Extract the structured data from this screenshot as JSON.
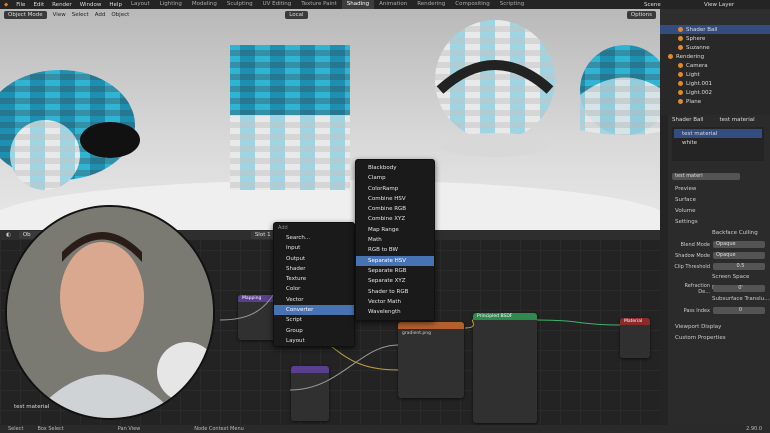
{
  "menubar": {
    "items": [
      "File",
      "Edit",
      "Render",
      "Window",
      "Help"
    ],
    "workspaces": [
      "Layout",
      "Lighting",
      "Modeling",
      "Sculpting",
      "UV Editing",
      "Texture Paint",
      "Shading",
      "Animation",
      "Rendering",
      "Compositing",
      "Scripting"
    ],
    "active_workspace": "Shading",
    "scene_label": "Scene",
    "view_layer_label": "View Layer"
  },
  "viewport": {
    "mode": "Object Mode",
    "menus": [
      "View",
      "Select",
      "Add",
      "Object"
    ],
    "orientation": "Local",
    "options": "Options"
  },
  "outliner": {
    "items": [
      {
        "label": "Shader Ball",
        "selected": true
      },
      {
        "label": "Sphere",
        "selected": false
      },
      {
        "label": "Suzanne",
        "selected": false
      },
      {
        "label": "Rendering",
        "selected": false
      },
      {
        "label": "Camera",
        "selected": false
      },
      {
        "label": "Light",
        "selected": false
      },
      {
        "label": "Light.001",
        "selected": false
      },
      {
        "label": "Light.002",
        "selected": false
      },
      {
        "label": "Plane",
        "selected": false
      }
    ]
  },
  "properties": {
    "object_name": "Shader Ball",
    "material_name": "test material",
    "slots": [
      "test material",
      "white"
    ],
    "material_field": "test materi",
    "sections": [
      "Preview",
      "Surface",
      "Volume",
      "Settings"
    ],
    "backface_culling": "Backface Culling",
    "blend_mode_label": "Blend Mode",
    "blend_mode_value": "Opaque",
    "shadow_mode_label": "Shadow Mode",
    "shadow_mode_value": "Opaque",
    "clip_threshold_label": "Clip Threshold",
    "clip_threshold_value": "0.5",
    "screen_space_refraction": "Screen Space Refra...",
    "refraction_depth_label": "Refraction De...",
    "refraction_depth_value": "0'",
    "subsurface_translucency": "Subsurface Translu...",
    "pass_index_label": "Pass Index",
    "pass_index_value": "0",
    "bottom_sections": [
      "Viewport Display",
      "Custom Properties"
    ]
  },
  "node_editor": {
    "slot_label": "Slot 1",
    "material_label": "test material"
  },
  "add_menu": {
    "title": "Add",
    "search": "Search...",
    "items": [
      "Input",
      "Output",
      "Shader",
      "Texture",
      "Color",
      "Vector",
      "Converter",
      "Script",
      "Group",
      "Layout"
    ],
    "highlighted": "Converter"
  },
  "converter_menu": {
    "items": [
      "Blackbody",
      "Clamp",
      "ColorRamp",
      "Combine HSV",
      "Combine RGB",
      "Combine XYZ",
      "Map Range",
      "Math",
      "RGB to BW",
      "Separate HSV",
      "Separate RGB",
      "Separate XYZ",
      "Shader to RGB",
      "Vector Math",
      "Wavelength"
    ],
    "highlighted": "Separate HSV"
  },
  "nodes": {
    "principled": "Principled BSDF",
    "output": "Material Output",
    "image": "gradient.png",
    "mapping": "Mapping"
  },
  "statusbar": {
    "items": [
      "Select",
      "Box Select",
      "Pan View",
      "Node Context Menu"
    ],
    "version": "2.90.0"
  },
  "colors": {
    "accent": "#4772b3",
    "selection": "#334d80",
    "cube_cyan": "#33b5d6"
  }
}
